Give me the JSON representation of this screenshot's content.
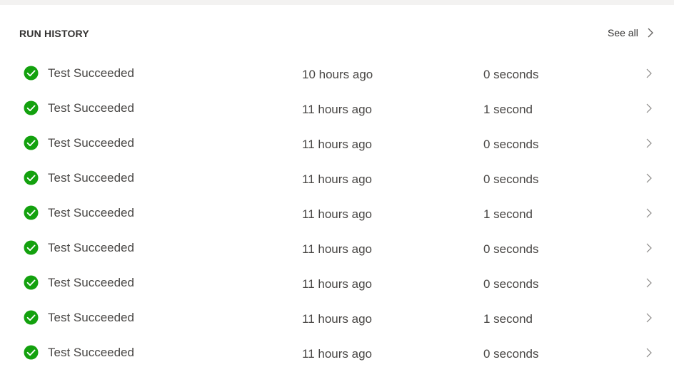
{
  "header": {
    "title": "RUN HISTORY",
    "see_all_label": "See all"
  },
  "colors": {
    "success_green": "#13a10e",
    "text": "#484644",
    "chevron": "#8a8886"
  },
  "rows": [
    {
      "status": "Test Succeeded",
      "time": "10 hours ago",
      "duration": "0 seconds",
      "icon": "check-circle-icon"
    },
    {
      "status": "Test Succeeded",
      "time": "11 hours ago",
      "duration": "1 second",
      "icon": "check-circle-icon"
    },
    {
      "status": "Test Succeeded",
      "time": "11 hours ago",
      "duration": "0 seconds",
      "icon": "check-circle-icon"
    },
    {
      "status": "Test Succeeded",
      "time": "11 hours ago",
      "duration": "0 seconds",
      "icon": "check-circle-icon"
    },
    {
      "status": "Test Succeeded",
      "time": "11 hours ago",
      "duration": "1 second",
      "icon": "check-circle-icon"
    },
    {
      "status": "Test Succeeded",
      "time": "11 hours ago",
      "duration": "0 seconds",
      "icon": "check-circle-icon"
    },
    {
      "status": "Test Succeeded",
      "time": "11 hours ago",
      "duration": "0 seconds",
      "icon": "check-circle-icon"
    },
    {
      "status": "Test Succeeded",
      "time": "11 hours ago",
      "duration": "1 second",
      "icon": "check-circle-icon"
    },
    {
      "status": "Test Succeeded",
      "time": "11 hours ago",
      "duration": "0 seconds",
      "icon": "check-circle-icon"
    }
  ]
}
